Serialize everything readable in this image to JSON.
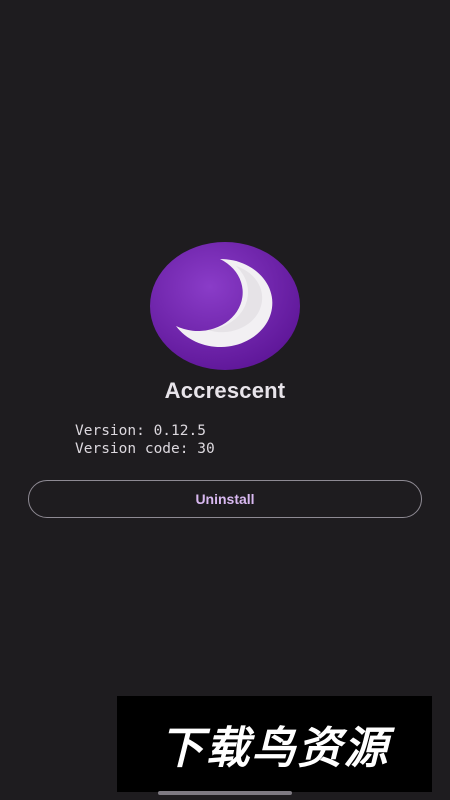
{
  "app": {
    "name": "Accrescent",
    "version_line": "Version: 0.12.5",
    "version_code_line": "Version code: 30"
  },
  "actions": {
    "uninstall_label": "Uninstall"
  },
  "watermark": {
    "text": "下载鸟资源"
  },
  "colors": {
    "background": "#1e1c1f",
    "logo_purple": "#6c1ea8",
    "button_text": "#d8b8f0",
    "button_border": "#8e8a93"
  },
  "icons": {
    "logo": "crescent-moon-icon"
  }
}
